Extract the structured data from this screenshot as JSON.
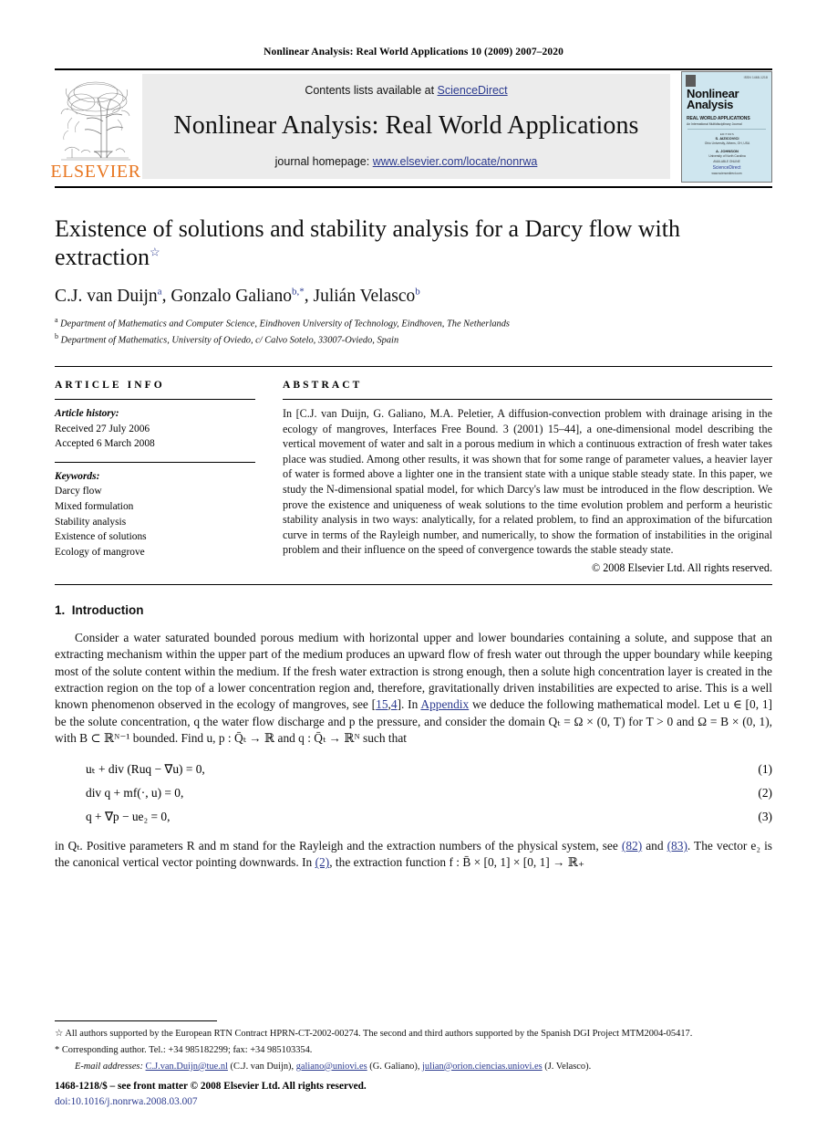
{
  "running_head": "Nonlinear Analysis: Real World Applications 10 (2009) 2007–2020",
  "banner": {
    "publisher_logo_text": "ELSEVIER",
    "contents_prefix": "Contents lists available at ",
    "contents_link": "ScienceDirect",
    "journal_title": "Nonlinear Analysis: Real World Applications",
    "homepage_prefix": "journal homepage: ",
    "homepage_link": "www.elsevier.com/locate/nonrwa",
    "cover": {
      "issn": "ISSN 1468-1218",
      "name_line1": "Nonlinear",
      "name_line2": "Analysis",
      "subtitle": "REAL WORLD APPLICATIONS",
      "subtitle2": "An International Multidisciplinary Journal",
      "editors_label": "EDITORS",
      "editor1": "S. AIZICOVICI",
      "editor1_aff": "Ohio University, Athens, OH, USA",
      "editor2": "A. JOHNSON",
      "editor2_aff": "University of North Carolina",
      "available_label": "AVAILABLE ONLINE",
      "sd_text": "ScienceDirect",
      "sd_url": "www.sciencedirect.com"
    }
  },
  "title": "Existence of solutions and stability analysis for a Darcy flow with extraction",
  "title_footnote_marker": "☆",
  "authors": [
    {
      "name": "C.J. van Duijn",
      "sup": "a"
    },
    {
      "name": "Gonzalo Galiano",
      "sup": "b,*"
    },
    {
      "name": "Julián Velasco",
      "sup": "b"
    }
  ],
  "affiliations": [
    {
      "marker": "a",
      "text": "Department of Mathematics and Computer Science, Eindhoven University of Technology, Eindhoven, The Netherlands"
    },
    {
      "marker": "b",
      "text": "Department of Mathematics, University of Oviedo, c/ Calvo Sotelo, 33007-Oviedo, Spain"
    }
  ],
  "article_info": {
    "heading": "ARTICLE INFO",
    "history_label": "Article history:",
    "history": [
      "Received 27 July 2006",
      "Accepted 6 March 2008"
    ],
    "keywords_label": "Keywords:",
    "keywords": [
      "Darcy flow",
      "Mixed formulation",
      "Stability analysis",
      "Existence of solutions",
      "Ecology of mangrove"
    ]
  },
  "abstract": {
    "heading": "ABSTRACT",
    "text": "In [C.J. van Duijn, G. Galiano, M.A. Peletier, A diffusion-convection problem with drainage arising in the ecology of mangroves, Interfaces Free Bound. 3 (2001) 15–44], a one-dimensional model describing the vertical movement of water and salt in a porous medium in which a continuous extraction of fresh water takes place was studied. Among other results, it was shown that for some range of parameter values, a heavier layer of water is formed above a lighter one in the transient state with a unique stable steady state. In this paper, we study the N-dimensional spatial model, for which Darcy's law must be introduced in the flow description. We prove the existence and uniqueness of weak solutions to the time evolution problem and perform a heuristic stability analysis in two ways: analytically, for a related problem, to find an approximation of the bifurcation curve in terms of the Rayleigh number, and numerically, to show the formation of instabilities in the original problem and their influence on the speed of convergence towards the stable steady state.",
    "italic_token": "N",
    "copyright": "© 2008 Elsevier Ltd. All rights reserved."
  },
  "section": {
    "number": "1.",
    "title": "Introduction",
    "paragraph_part1": "Consider a water saturated bounded porous medium with horizontal upper and lower boundaries containing a solute, and suppose that an extracting mechanism within the upper part of the medium produces an upward flow of fresh water out through the upper boundary while keeping most of the solute content within the medium. If the fresh water extraction is strong enough, then a solute high concentration layer is created in the extraction region on the top of a lower concentration region and, therefore, gravitationally driven instabilities are expected to arise. This is a well known phenomenon observed in the ecology of mangroves, see [",
    "ref_15": "15",
    "ref_4": "4",
    "paragraph_part2": "]. In ",
    "appendix_link": "Appendix",
    "paragraph_part3": " we deduce the following mathematical model. Let u ∈ [0, 1] be the solute concentration, q the water flow discharge and p the pressure, and consider the domain Qₜ = Ω × (0, T) for T > 0 and Ω = B × (0, 1), with B ⊂ ℝᴺ⁻¹ bounded. Find u, p : Q̄ₜ → ℝ and q : Q̄ₜ → ℝᴺ such that"
  },
  "equations": [
    {
      "body": "uₜ + div (Ruq − ∇u) = 0,",
      "number": "(1)"
    },
    {
      "body": "div q + mf(·, u) = 0,",
      "number": "(2)"
    },
    {
      "body": "q + ∇p − ue₂ = 0,",
      "number": "(3)"
    }
  ],
  "after_equations": {
    "part1": "in Qₜ. Positive parameters R and m stand for the Rayleigh and the extraction numbers of the physical system, see ",
    "ref_82": "(82)",
    "part2": " and ",
    "ref_83": "(83)",
    "part3": ". The vector e₂ is the canonical vertical vector pointing downwards. In ",
    "ref_2": "(2)",
    "part4": ", the extraction function f : B̄ × [0, 1] × [0, 1] → ℝ₊"
  },
  "footnotes": {
    "star_marker": "☆",
    "star_text": "All authors supported by the European RTN Contract HPRN-CT-2002-00274. The second and third authors supported by the Spanish DGI Project MTM2004-05417.",
    "corr_marker": "*",
    "corr_text": "Corresponding author. Tel.: +34 985182299; fax: +34 985103354.",
    "email_label": "E-mail addresses:",
    "emails": [
      {
        "address": "C.J.van.Duijn@tue.nl",
        "owner": "(C.J. van Duijn)"
      },
      {
        "address": "galiano@uniovi.es",
        "owner": "(G. Galiano)"
      },
      {
        "address": "julian@orion.ciencias.uniovi.es",
        "owner": "(J. Velasco)"
      }
    ]
  },
  "imprint": {
    "line1": "1468-1218/$ – see front matter © 2008 Elsevier Ltd. All rights reserved.",
    "doi": "doi:10.1016/j.nonrwa.2008.03.007"
  },
  "colors": {
    "link": "#2b3a8f",
    "elsevier_orange": "#E87722",
    "banner_bg": "#ececec",
    "cover_bg": "#cfe6ef"
  }
}
